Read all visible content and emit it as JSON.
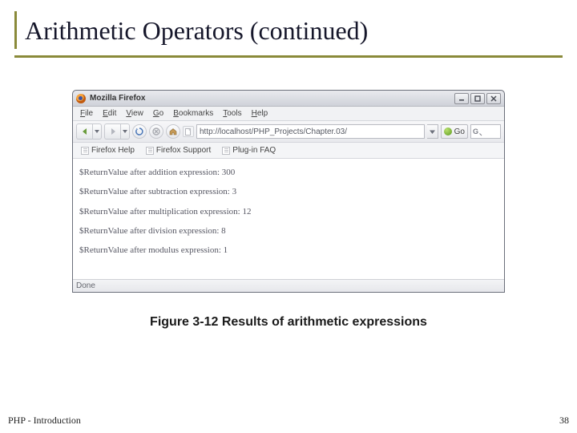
{
  "slide": {
    "title": "Arithmetic Operators (continued)",
    "caption": "Figure 3-12 Results of arithmetic expressions",
    "footer_left": "PHP - Introduction",
    "footer_right": "38"
  },
  "browser": {
    "window_title": "Mozilla Firefox",
    "menus": {
      "file": "File",
      "edit": "Edit",
      "view": "View",
      "go": "Go",
      "bookmarks": "Bookmarks",
      "tools": "Tools",
      "help": "Help"
    },
    "address_url": "http://localhost/PHP_Projects/Chapter.03/",
    "go_label": "Go",
    "bookmarks_bar": {
      "help": "Firefox Help",
      "support": "Firefox Support",
      "plugin": "Plug-in FAQ"
    },
    "output": {
      "line1": "$ReturnValue after addition expression: 300",
      "line2": "$ReturnValue after subtraction expression: 3",
      "line3": "$ReturnValue after multiplication expression: 12",
      "line4": "$ReturnValue after division expression: 8",
      "line5": "$ReturnValue after modulus expression: 1"
    },
    "status_text": "Done"
  }
}
